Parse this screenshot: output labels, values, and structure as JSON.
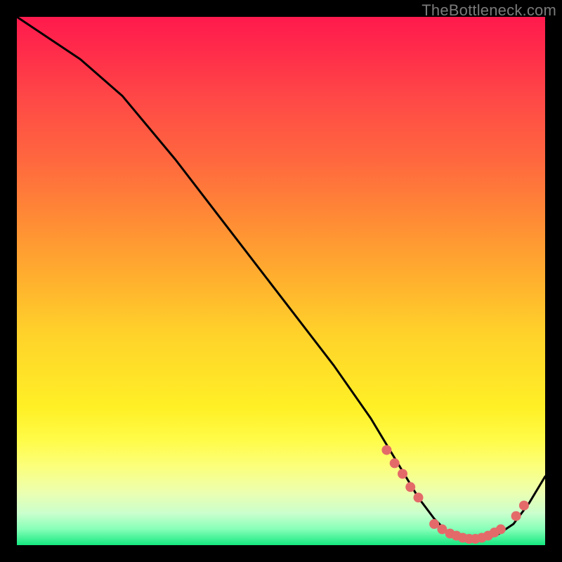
{
  "watermark": "TheBottleneck.com",
  "chart_data": {
    "type": "line",
    "title": "",
    "xlabel": "",
    "ylabel": "",
    "xlim": [
      0,
      100
    ],
    "ylim": [
      0,
      100
    ],
    "series": [
      {
        "name": "curve",
        "x": [
          0,
          6,
          12,
          20,
          30,
          40,
          50,
          60,
          67,
          73,
          76,
          79,
          82,
          85,
          88,
          91,
          94,
          97,
          100
        ],
        "y": [
          100,
          96,
          92,
          85,
          73,
          60,
          47,
          34,
          24,
          14,
          9,
          5,
          2,
          1,
          1,
          2,
          4,
          8,
          13
        ]
      }
    ],
    "markers": [
      {
        "x": 70.0,
        "y": 18.0
      },
      {
        "x": 71.5,
        "y": 15.5
      },
      {
        "x": 73.0,
        "y": 13.5
      },
      {
        "x": 74.5,
        "y": 11.0
      },
      {
        "x": 76.0,
        "y": 9.0
      },
      {
        "x": 79.0,
        "y": 4.0
      },
      {
        "x": 80.5,
        "y": 3.0
      },
      {
        "x": 82.0,
        "y": 2.2
      },
      {
        "x": 83.2,
        "y": 1.8
      },
      {
        "x": 84.4,
        "y": 1.4
      },
      {
        "x": 85.6,
        "y": 1.2
      },
      {
        "x": 86.8,
        "y": 1.2
      },
      {
        "x": 88.0,
        "y": 1.4
      },
      {
        "x": 89.2,
        "y": 1.8
      },
      {
        "x": 90.4,
        "y": 2.4
      },
      {
        "x": 91.6,
        "y": 3.0
      },
      {
        "x": 94.5,
        "y": 5.5
      },
      {
        "x": 96.0,
        "y": 7.5
      }
    ],
    "marker_color": "#e46a6a",
    "line_color": "#000000"
  }
}
